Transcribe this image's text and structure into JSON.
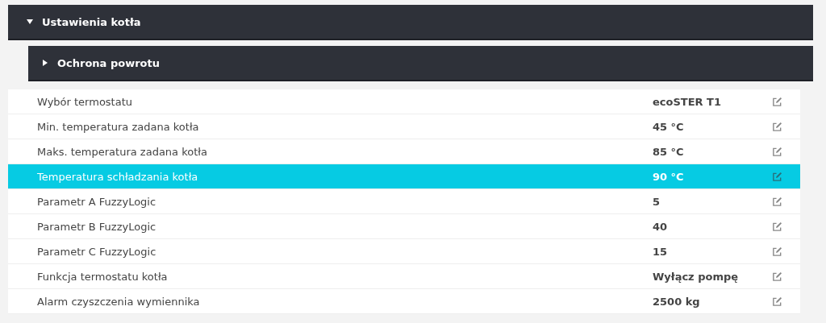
{
  "section": {
    "title": "Ustawienia kotła",
    "expanded": true
  },
  "subsection": {
    "title": "Ochrona powrotu",
    "expanded": false
  },
  "rows": [
    {
      "label": "Wybór termostatu",
      "value": "ecoSTER T1",
      "selected": false
    },
    {
      "label": "Min. temperatura zadana kotła",
      "value": "45 °C",
      "selected": false
    },
    {
      "label": "Maks. temperatura zadana kotła",
      "value": "85 °C",
      "selected": false
    },
    {
      "label": "Temperatura schładzania kotła",
      "value": "90 °C",
      "selected": true
    },
    {
      "label": "Parametr A FuzzyLogic",
      "value": "5",
      "selected": false
    },
    {
      "label": "Parametr B FuzzyLogic",
      "value": "40",
      "selected": false
    },
    {
      "label": "Parametr C FuzzyLogic",
      "value": "15",
      "selected": false
    },
    {
      "label": "Funkcja termostatu kotła",
      "value": "Wyłącz pompę",
      "selected": false
    },
    {
      "label": "Alarm czyszczenia wymiennika",
      "value": "2500 kg",
      "selected": false
    }
  ]
}
